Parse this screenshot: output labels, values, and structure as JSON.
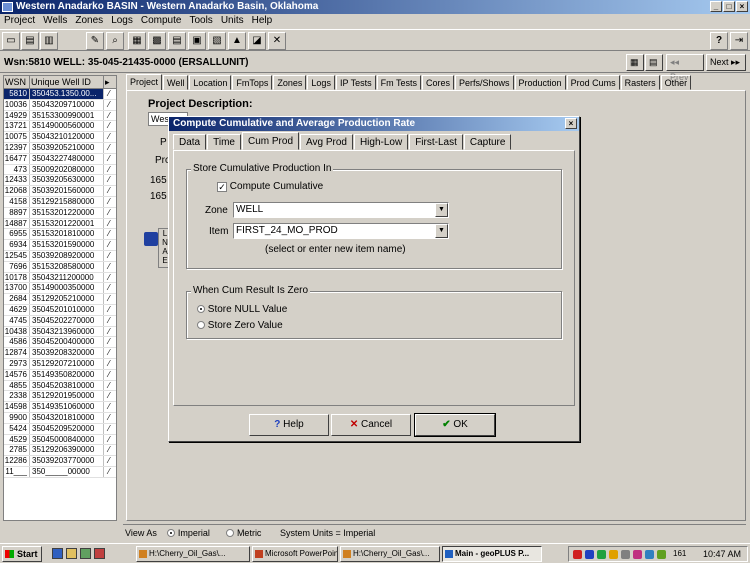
{
  "window": {
    "title": "Western Anadarko BASIN - Western Anadarko Basin, Oklahoma"
  },
  "menu": [
    "Project",
    "Wells",
    "Zones",
    "Logs",
    "Compute",
    "Tools",
    "Units",
    "Help"
  ],
  "wellbar": {
    "label": "Wsn:5810 WELL: 35-045-21435-0000 (ERSALLUNIT)",
    "prev": "Prev",
    "next": "Next"
  },
  "grid": {
    "headers": [
      "WSN",
      "Unique Well ID"
    ],
    "rows": [
      [
        "5810",
        "350453.1350.00..."
      ],
      [
        "10036",
        "35043209710000"
      ],
      [
        "14929",
        "35153300990001"
      ],
      [
        "13721",
        "35149000560000"
      ],
      [
        "10075",
        "35043210120000"
      ],
      [
        "12397",
        "35039205210000"
      ],
      [
        "16477",
        "35043227480000"
      ],
      [
        "473",
        "35009202080000"
      ],
      [
        "12433",
        "35039205630000"
      ],
      [
        "12068",
        "35039201560000"
      ],
      [
        "4158",
        "35129215880000"
      ],
      [
        "8897",
        "35153201220000"
      ],
      [
        "14887",
        "35153201220001"
      ],
      [
        "6955",
        "35153201810000"
      ],
      [
        "6934",
        "35153201590000"
      ],
      [
        "12545",
        "35039208920000"
      ],
      [
        "7696",
        "35153208580000"
      ],
      [
        "10178",
        "35043211200000"
      ],
      [
        "13700",
        "35149000350000"
      ],
      [
        "2684",
        "35129205210000"
      ],
      [
        "4629",
        "35045201010000"
      ],
      [
        "4745",
        "35045202270000"
      ],
      [
        "10438",
        "35043213960000"
      ],
      [
        "4586",
        "35045200400000"
      ],
      [
        "12874",
        "35039208320000"
      ],
      [
        "2973",
        "35129207210000"
      ],
      [
        "14576",
        "35149350820000"
      ],
      [
        "4855",
        "35045203810000"
      ],
      [
        "2338",
        "35129201950000"
      ],
      [
        "14598",
        "35149351060000"
      ],
      [
        "9900",
        "35043201810000"
      ],
      [
        "5424",
        "35045209520000"
      ],
      [
        "4529",
        "35045000840000"
      ],
      [
        "2785",
        "35129206390000"
      ],
      [
        "12286",
        "35039203770000"
      ],
      [
        "11___",
        "350_____00000"
      ]
    ]
  },
  "main_tabs": [
    "Project",
    "Well",
    "Location",
    "FmTops",
    "Zones",
    "Logs",
    "IP Tests",
    "Fm Tests",
    "Cores",
    "Perfs/Shows",
    "Production",
    "Prod Cums",
    "Rasters",
    "Other"
  ],
  "project": {
    "desc_label": "Project Description:",
    "desc_value": "Wes",
    "bg_p1": "P",
    "bg_pro": "Pro",
    "bg_165a": "165",
    "bg_165b": "165",
    "bg_box": "L N A E"
  },
  "status": {
    "view_as": "View As",
    "imperial": "Imperial",
    "metric": "Metric",
    "system_units": "System Units = Imperial"
  },
  "dialog": {
    "title": "Compute Cumulative and Average Production Rate",
    "tabs": [
      "Data",
      "Time",
      "Cum Prod",
      "Avg Prod",
      "High-Low",
      "First-Last",
      "Capture"
    ],
    "group1_title": "Store Cumulative Production In",
    "compute_cum": "Compute Cumulative",
    "zone_label": "Zone",
    "zone_value": "WELL",
    "item_label": "Item",
    "item_value": "FIRST_24_MO_PROD",
    "hint": "(select or enter new item name)",
    "group2_title": "When Cum Result Is Zero",
    "opt_null": "Store NULL Value",
    "opt_zero": "Store Zero Value",
    "help": "Help",
    "cancel": "Cancel",
    "ok": "OK"
  },
  "taskbar": {
    "start": "Start",
    "tasks": [
      "H:\\Cherry_Oil_Gas\\...",
      "Microsoft PowerPoin...",
      "H:\\Cherry_Oil_Gas\\...",
      "Main - geoPLUS P..."
    ],
    "tray_num": "161",
    "clock": "10:47 AM"
  }
}
